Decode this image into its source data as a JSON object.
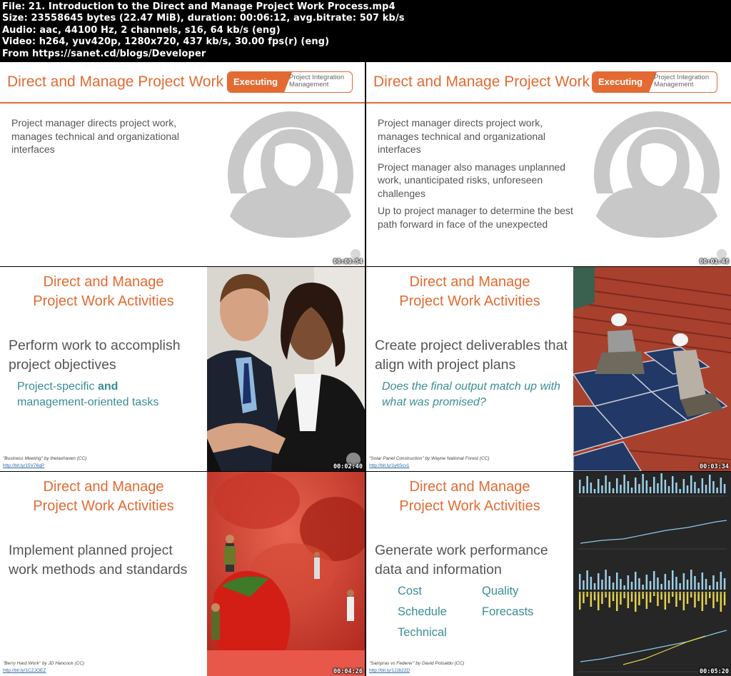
{
  "header": {
    "file": "File: 21. Introduction to the Direct and Manage Project Work Process.mp4",
    "size": "Size: 23558645 bytes (22.47 MiB), duration: 00:06:12, avg.bitrate: 507 kb/s",
    "audio": "Audio: aac, 44100 Hz, 2 channels, s16, 64 kb/s (eng)",
    "video": "Video: h264, yuv420p, 1280x720, 437 kb/s, 30.00 fps(r) (eng)",
    "from": "From https://sanet.cd/blogs/Developer"
  },
  "slide1": {
    "title": "Direct and Manage Project Work",
    "badge_exec": "Executing",
    "badge_pim_1": "Project Integration",
    "badge_pim_2": "Management",
    "p1": "Project manager directs project work, manages technical and organizational interfaces",
    "timestamp": "00:00:54"
  },
  "slide2": {
    "title": "Direct and Manage Project Work",
    "badge_exec": "Executing",
    "badge_pim_1": "Project Integration",
    "badge_pim_2": "Management",
    "p1": "Project manager directs project work, manages technical and organizational interfaces",
    "p2": "Project manager also manages unplanned work, unanticipated risks, unforeseen challenges",
    "p3": "Up to project manager to determine the best path forward in face of the unexpected",
    "timestamp": "00:01:48"
  },
  "slide3": {
    "title_1": "Direct and Manage",
    "title_2": "Project Work Activities",
    "main": "Perform work to accomplish project objectives",
    "sub_1": "Project-specific",
    "sub_and": "and",
    "sub_2": "management-oriented tasks",
    "credit": "\"Business Meeting\" by thetaxhaven (CC)",
    "link": "http://bit.ly/15V76qP",
    "timestamp": "00:02:40"
  },
  "slide4": {
    "title_1": "Direct and Manage",
    "title_2": "Project Work Activities",
    "main": "Create project deliverables that align with project plans",
    "sub": "Does the final output match up with what was promised?",
    "credit": "\"Solar Panel Construction\" by Wayne National Forest (CC)",
    "link": "http://bit.ly/1y6Scv1",
    "timestamp": "00:03:34"
  },
  "slide5": {
    "title_1": "Direct and Manage",
    "title_2": "Project Work Activities",
    "main": "Implement planned project work methods and standards",
    "credit": "\"Berry Hard Work\" by JD Hancock (CC)",
    "link": "http://bit.ly/1CZJOEZ",
    "timestamp": "00:04:26"
  },
  "slide6": {
    "title_1": "Direct and Manage",
    "title_2": "Project Work Activities",
    "main": "Generate work performance data and information",
    "metrics": [
      "Cost",
      "Quality",
      "Schedule",
      "Forecasts",
      "Technical"
    ],
    "credit": "\"Sampras vs Federer\" by David Potsaldo (CC)",
    "link": "http://bit.ly/1JJb22D",
    "timestamp": "00:05:20"
  },
  "colors": {
    "accent": "#e36a32",
    "teal": "#3a8d94",
    "text": "#555555"
  }
}
